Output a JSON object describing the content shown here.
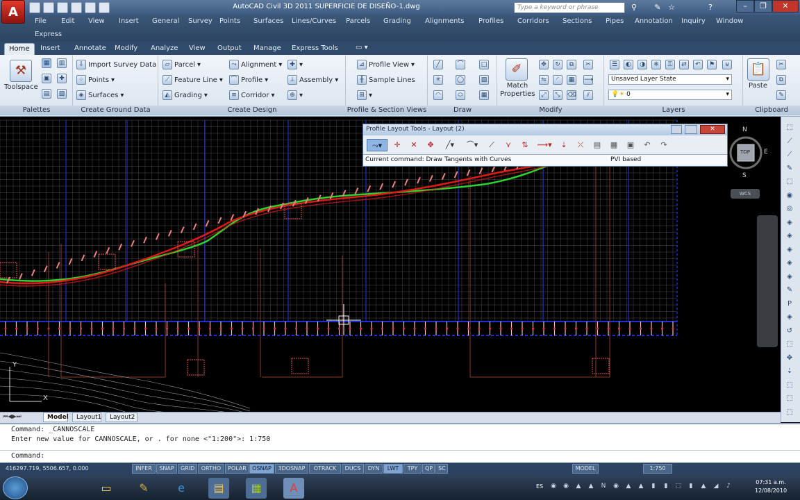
{
  "app": {
    "window_title": "AutoCAD Civil 3D 2011    SUPERFICIE DE DISEÑO-1.dwg",
    "search_placeholder": "Type a keyword or phrase"
  },
  "menus": [
    "File",
    "Edit",
    "View",
    "Insert",
    "General",
    "Survey",
    "Points",
    "Surfaces",
    "Lines/Curves",
    "Parcels",
    "Grading",
    "Alignments",
    "Profiles",
    "Corridors",
    "Sections",
    "Pipes",
    "Annotation",
    "Inquiry",
    "Window",
    "Express"
  ],
  "ribbon_tabs": [
    "Home",
    "Insert",
    "Annotate",
    "Modify",
    "Analyze",
    "View",
    "Output",
    "Manage",
    "Express Tools"
  ],
  "ribbon": {
    "toolspace": "Toolspace",
    "import_survey": "Import Survey Data",
    "points": "Points",
    "surfaces": "Surfaces",
    "parcel": "Parcel",
    "feature_line": "Feature Line",
    "grading": "Grading",
    "alignment": "Alignment",
    "profile": "Profile",
    "corridor": "Corridor",
    "assembly": "Assembly",
    "profile_view": "Profile View",
    "sample_lines": "Sample Lines",
    "match_properties": "Match Properties",
    "layer_state": "Unsaved Layer State",
    "layer_current": "0",
    "paste": "Paste",
    "panels": [
      "Palettes",
      "Create Ground Data",
      "Create Design",
      "Profile & Section Views",
      "Draw",
      "Modify",
      "Layers",
      "Clipboard"
    ]
  },
  "palette": {
    "title": "Profile Layout Tools - Layout (2)",
    "current_command": "Current command: Draw Tangents with Curves",
    "mode": "PVI based"
  },
  "viewcube": {
    "north": "N",
    "south": "S",
    "east": "E",
    "top": "TOP",
    "wcs": "WCS"
  },
  "layout_tabs": [
    "Model",
    "Layout1",
    "Layout2"
  ],
  "command_lines": [
    "Command: _CANNOSCALE",
    "Enter new value for CANNOSCALE, or . for none <\"1:200\">: 1:750"
  ],
  "command_prompt": "Command:",
  "status": {
    "coords": "416297.719, 5506.657, 0.000",
    "toggles": [
      {
        "label": "INFER",
        "on": false
      },
      {
        "label": "SNAP",
        "on": false
      },
      {
        "label": "GRID",
        "on": false
      },
      {
        "label": "ORTHO",
        "on": false
      },
      {
        "label": "POLAR",
        "on": false
      },
      {
        "label": "OSNAP",
        "on": true
      },
      {
        "label": "3DOSNAP",
        "on": false
      },
      {
        "label": "OTRACK",
        "on": false
      },
      {
        "label": "DUCS",
        "on": false
      },
      {
        "label": "DYN",
        "on": false
      },
      {
        "label": "LWT",
        "on": true
      },
      {
        "label": "TPY",
        "on": false
      },
      {
        "label": "QP",
        "on": false
      },
      {
        "label": "SC",
        "on": false
      }
    ],
    "model": "MODEL",
    "scale": "1:750"
  },
  "taskbar": {
    "lang": "ES",
    "time": "07:31 a.m.",
    "date": "12/08/2010"
  },
  "colors": {
    "ground": "#2fd12f",
    "design": "#e01818",
    "grid": "#6f6f6f",
    "gridline_blue": "#1f2fd1"
  }
}
